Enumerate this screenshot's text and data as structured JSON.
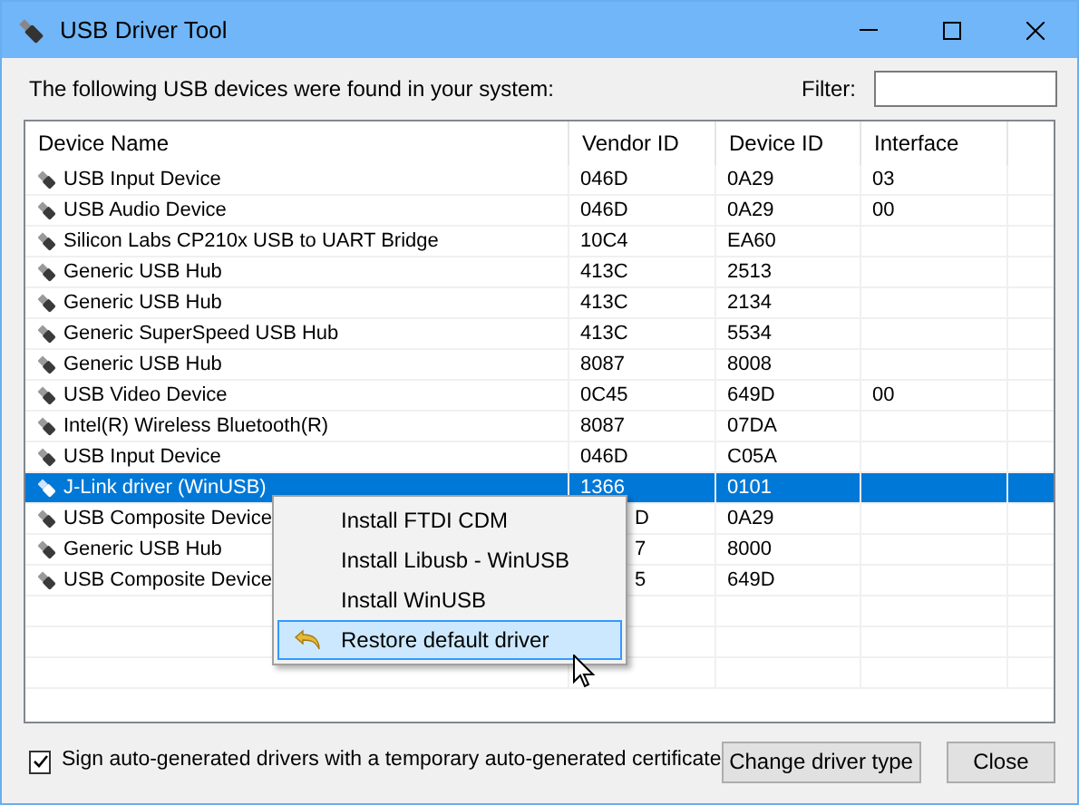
{
  "window": {
    "title": "USB Driver Tool"
  },
  "intro": "The following USB devices were found in your system:",
  "filter": {
    "label": "Filter:"
  },
  "table": {
    "columns": [
      "Device Name",
      "Vendor ID",
      "Device ID",
      "Interface"
    ],
    "rows": [
      {
        "name": "USB Input Device",
        "vendor": "046D",
        "device": "0A29",
        "interface": "03",
        "selected": false,
        "covered": false
      },
      {
        "name": "USB Audio Device",
        "vendor": "046D",
        "device": "0A29",
        "interface": "00",
        "selected": false,
        "covered": false
      },
      {
        "name": "Silicon Labs CP210x USB to UART Bridge",
        "vendor": "10C4",
        "device": "EA60",
        "selected": false,
        "covered": false
      },
      {
        "name": "Generic USB Hub",
        "vendor": "413C",
        "device": "2513",
        "selected": false,
        "covered": false
      },
      {
        "name": "Generic USB Hub",
        "vendor": "413C",
        "device": "2134",
        "selected": false,
        "covered": false
      },
      {
        "name": "Generic SuperSpeed USB Hub",
        "vendor": "413C",
        "device": "5534",
        "selected": false,
        "covered": false
      },
      {
        "name": "Generic USB Hub",
        "vendor": "8087",
        "device": "8008",
        "selected": false,
        "covered": false
      },
      {
        "name": "USB Video Device",
        "vendor": "0C45",
        "device": "649D",
        "interface": "00",
        "selected": false,
        "covered": false
      },
      {
        "name": "Intel(R) Wireless Bluetooth(R)",
        "vendor": "8087",
        "device": "07DA",
        "selected": false,
        "covered": false
      },
      {
        "name": "USB Input Device",
        "vendor": "046D",
        "device": "C05A",
        "selected": false,
        "covered": false
      },
      {
        "name": "J-Link driver (WinUSB)",
        "vendor": "1366",
        "device": "0101",
        "selected": true,
        "covered": false
      },
      {
        "name": "USB Composite Device",
        "vendor": "D",
        "device": "0A29",
        "selected": false,
        "covered": true
      },
      {
        "name": "Generic USB Hub",
        "vendor": "7",
        "device": "8000",
        "selected": false,
        "covered": true
      },
      {
        "name": "USB Composite Device",
        "vendor": "5",
        "device": "649D",
        "selected": false,
        "covered": true
      }
    ]
  },
  "context_menu": [
    {
      "label": "Install FTDI CDM",
      "selected": false
    },
    {
      "label": "Install Libusb - WinUSB",
      "selected": false
    },
    {
      "label": "Install WinUSB",
      "selected": false
    },
    {
      "label": "Restore default driver",
      "selected": true,
      "kind": "restore"
    }
  ],
  "sign_checkbox": {
    "label": "Sign auto-generated drivers with a temporary auto-generated certificate",
    "checked": true
  },
  "buttons": [
    "Change driver type",
    "Close"
  ]
}
